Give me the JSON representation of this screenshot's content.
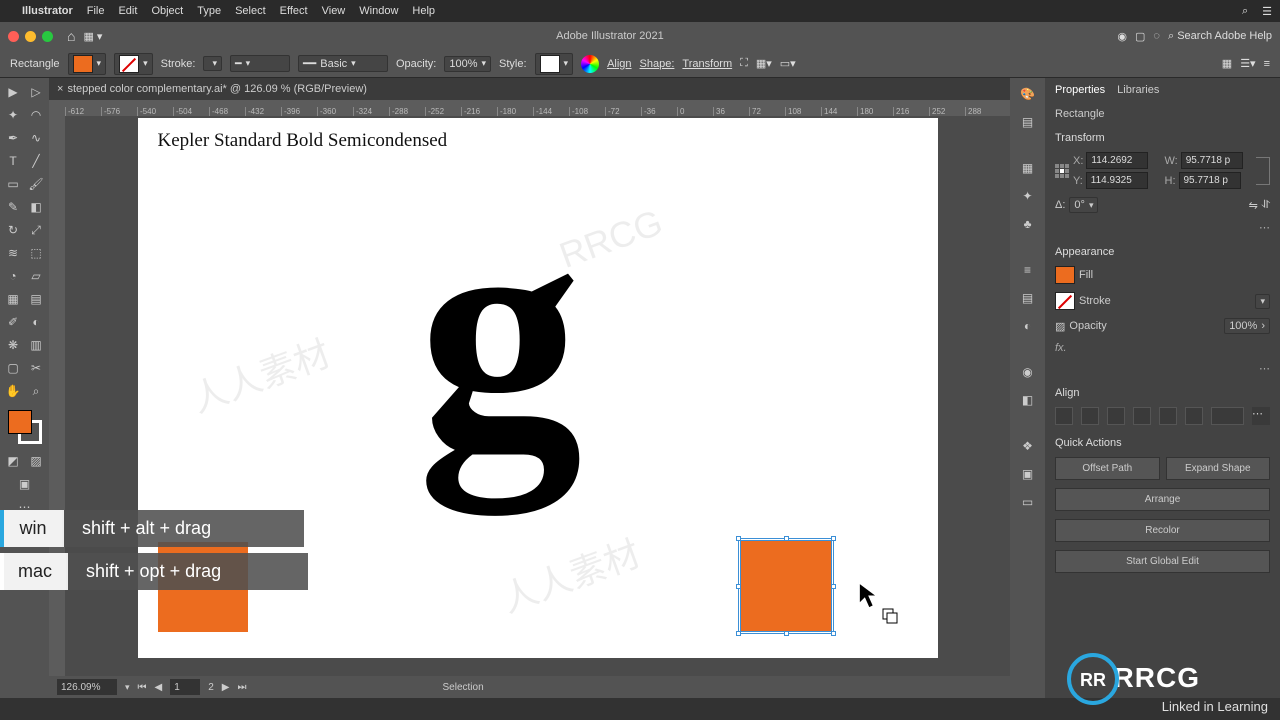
{
  "app": {
    "title": "Adobe Illustrator 2021",
    "menus": [
      "Illustrator",
      "File",
      "Edit",
      "Object",
      "Type",
      "Select",
      "Effect",
      "View",
      "Window",
      "Help"
    ],
    "search_placeholder": "Search Adobe Help"
  },
  "controlbar": {
    "shape_name": "Rectangle",
    "stroke_label": "Stroke:",
    "stroke_weight": "",
    "brush_label": "Basic",
    "opacity_label": "Opacity:",
    "opacity_value": "100%",
    "style_label": "Style:",
    "align_label": "Align",
    "shape_btn": "Shape:",
    "transform_btn": "Transform"
  },
  "document": {
    "tab_label": "stepped color complementary.ai* @ 126.09 % (RGB/Preview)",
    "title_text": "Kepler Standard Bold Semicondensed",
    "big_letter": "g",
    "ruler_ticks": [
      "-612",
      "-576",
      "-540",
      "-504",
      "-468",
      "-432",
      "-396",
      "-360",
      "-324",
      "-288",
      "-252",
      "-216",
      "-180",
      "-144",
      "-108",
      "-72",
      "-36",
      "0",
      "36",
      "72",
      "108",
      "144",
      "180",
      "216",
      "252",
      "288"
    ]
  },
  "statusbar": {
    "zoom": "126.09%",
    "artboard_nav": "1",
    "artboard_total": "2",
    "mode": "Selection"
  },
  "properties": {
    "tabs": [
      "Properties",
      "Libraries"
    ],
    "obj_type": "Rectangle",
    "transform_label": "Transform",
    "x_label": "X:",
    "x_val": "114.2692",
    "y_label": "Y:",
    "y_val": "114.9325",
    "w_label": "W:",
    "w_val": "95.7718 p",
    "h_label": "H:",
    "h_val": "95.7718 p",
    "angle_label": "Δ:",
    "angle_val": "0°",
    "appearance_label": "Appearance",
    "fill_label": "Fill",
    "stroke_label": "Stroke",
    "opacity_label": "Opacity",
    "opacity_val": "100%",
    "fx_label": "fx.",
    "align_label": "Align",
    "quick_actions_label": "Quick Actions",
    "qa_buttons": [
      "Offset Path",
      "Expand Shape",
      "Arrange",
      "Recolor",
      "Start Global Edit"
    ]
  },
  "overlay": {
    "win_label": "win",
    "win_combo": "shift + alt + drag",
    "mac_label": "mac",
    "mac_combo": "shift + opt + drag"
  },
  "colors": {
    "orange": "#ec6c1f"
  },
  "brand": {
    "lil": "Linked in Learning",
    "rrcg": "RRCG"
  }
}
